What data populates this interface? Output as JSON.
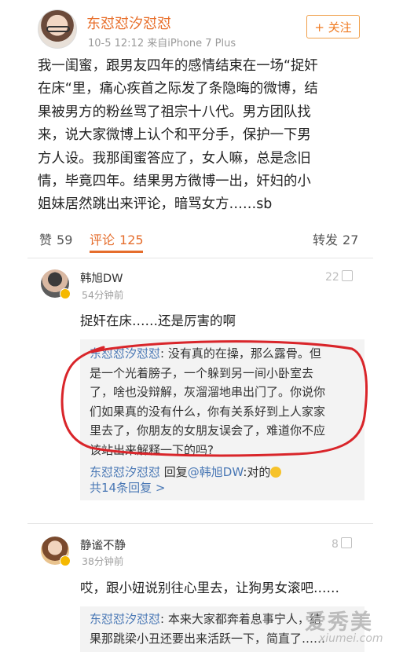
{
  "post": {
    "author": "东怼怼汐怼怼",
    "time": "10-5 12:12",
    "source": "来自iPhone 7 Plus",
    "follow_label": "+ 关注",
    "body_lines": [
      "我一闺蜜，跟男友四年的感情结束在一场“捉奸",
      "在床“里，痛心疾首之际发了条隐晦的微博，结",
      "果被男方的粉丝骂了祖宗十八代。男方团队找",
      "来，说大家微博上认个和平分手，保护一下男",
      "方人设。我那闺蜜答应了，女人嘛，总是念旧",
      "情，毕竟四年。结果男方微博一出，奸妇的小",
      "姐妹居然跳出来评论，暗骂女方……sb"
    ]
  },
  "actions": {
    "like_label": "赞",
    "like_count": "59",
    "comment_label": "评论",
    "comment_count": "125",
    "repost_label": "转发",
    "repost_count": "27"
  },
  "comments": [
    {
      "name": "韩旭DW",
      "time": "54分钟前",
      "likes": "22",
      "text": "捉奸在床……还是厉害的啊",
      "reply_lines": [
        {
          "author": "东怼怼汐怼怼",
          "text": ": 没有真的在操，那么露骨。但"
        },
        {
          "text": "是一个光着膀子，一个躲到另一间小卧室去"
        },
        {
          "text": "了，啥也没辩解，灰溜溜地串出门了。你说你"
        },
        {
          "text": "们如果真的没有什么，你有关系好到上人家家"
        },
        {
          "text": "里去了，你朋友的女朋友误会了，难道你不应"
        },
        {
          "text": "该站出来解释一下的吗?"
        }
      ],
      "reply2_author": "东怼怼汐怼怼",
      "reply2_prefix": " 回复",
      "reply2_link": "@韩旭DW",
      "reply2_text": ":对的",
      "more_replies": "共14条回复 >"
    },
    {
      "name": "静谧不静",
      "time": "38分钟前",
      "likes": "8",
      "text": "哎，跟小妞说别往心里去，让狗男女滚吧……",
      "reply_lines": [
        {
          "author": "东怼怼汐怼怼",
          "text": ": 本来大家都奔着息事宁人，结"
        },
        {
          "text": "果那跳梁小丑还要出来活跃一下，简直了……"
        }
      ]
    }
  ],
  "watermark": {
    "cn": "爱秀美",
    "en": "xiumei.com"
  },
  "colors": {
    "accent": "#e56d2c",
    "link": "#4a78b5",
    "annotation": "#d9252a"
  }
}
